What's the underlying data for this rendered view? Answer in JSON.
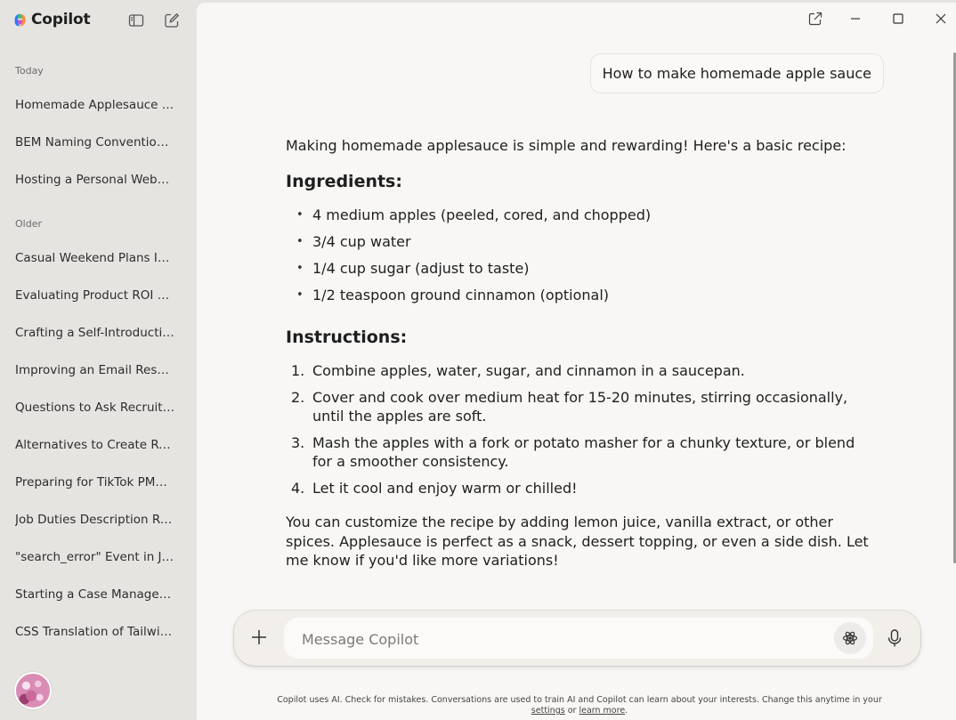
{
  "app": {
    "name": "Copilot"
  },
  "sidebar": {
    "sections": [
      {
        "label": "Today",
        "items": [
          "Homemade Applesauce R...",
          "BEM Naming Convention...",
          "Hosting a Personal Websit..."
        ]
      },
      {
        "label": "Older",
        "items": [
          "Casual Weekend Plans Inq...",
          "Evaluating Product ROI M...",
          "Crafting a Self-Introduction",
          "Improving an Email Respo...",
          "Questions to Ask Recruiter...",
          "Alternatives to Create Rea...",
          "Preparing for TikTok PMO...",
          "Job Duties Description Re...",
          "\"search_error\" Event in Ja...",
          "Starting a Case Managem...",
          "CSS Translation of Tailwind..."
        ]
      }
    ]
  },
  "chat": {
    "user_message": "How to make homemade apple sauce",
    "response": {
      "intro": "Making homemade applesauce is simple and rewarding! Here's a basic recipe:",
      "ingredients_heading": "Ingredients:",
      "ingredients": [
        "4 medium apples (peeled, cored, and chopped)",
        "3/4 cup water",
        "1/4 cup sugar (adjust to taste)",
        "1/2 teaspoon ground cinnamon (optional)"
      ],
      "instructions_heading": "Instructions:",
      "instructions": [
        {
          "num": "1.",
          "text": "Combine apples, water, sugar, and cinnamon in a saucepan."
        },
        {
          "num": "2.",
          "text": "Cover and cook over medium heat for 15-20 minutes, stirring occasionally, until the apples are soft."
        },
        {
          "num": "3.",
          "text": "Mash the apples with a fork or potato masher for a chunky texture, or blend for a smoother consistency."
        },
        {
          "num": "4.",
          "text": "Let it cool and enjoy warm or chilled!"
        }
      ],
      "outro": "You can customize the recipe by adding lemon juice, vanilla extract, or other spices. Applesauce is perfect as a snack, dessert topping, or even a side dish. Let me know if you'd like more variations!"
    }
  },
  "composer": {
    "placeholder": "Message Copilot",
    "value": ""
  },
  "disclaimer": {
    "text": "Copilot uses AI. Check for mistakes. Conversations are used to train AI and Copilot can learn about your interests. Change this anytime in your",
    "settings_link": "settings",
    "or": "or",
    "learn_more_link": "learn more",
    "end": "."
  },
  "icons": {
    "sidebar_toggle": "sidebar-toggle-icon",
    "new_chat": "new-chat-icon",
    "popout": "popout-icon",
    "minimize": "minimize-icon",
    "maximize": "maximize-icon",
    "close": "close-icon",
    "plus": "plus-icon",
    "think_deeper": "think-deeper-icon",
    "mic": "microphone-icon"
  }
}
